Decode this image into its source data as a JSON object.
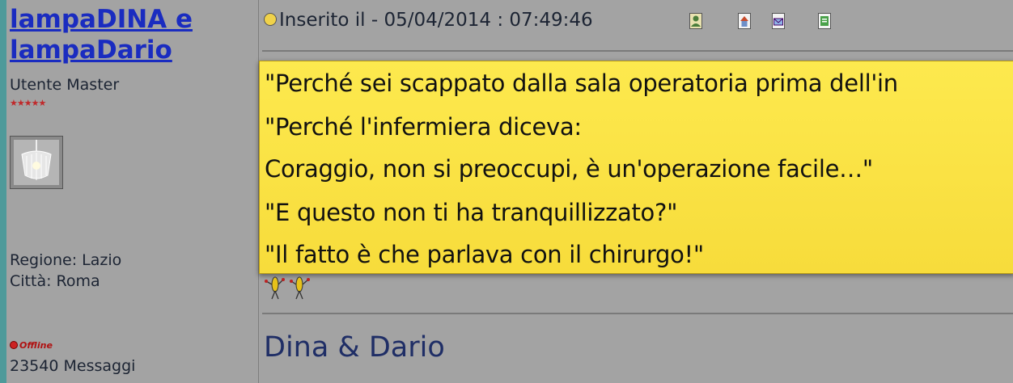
{
  "author": {
    "name": "lampaDINA e lampaDario",
    "rank": "Utente Master",
    "stars": "★★★★★"
  },
  "profile": {
    "region": "Regione: Lazio",
    "city": "Città: Roma",
    "status": "Offline",
    "messages": "23540 Messaggi"
  },
  "post": {
    "inserted": "Inserito il - 05/04/2014 : 07:49:46"
  },
  "note_lines": [
    "\"Perché sei scappato dalla sala operatoria prima dell'in",
    "\"Perché l'infermiera diceva:",
    "Coraggio, non si preoccupi, è un'operazione facile…\"",
    "\"E questo non ti ha tranquillizzato?\"",
    "\"Il fatto è che parlava con il chirurgo!\""
  ],
  "signature": "Dina & Dario",
  "colors": {
    "background": "#a3a3a3",
    "link": "#1a2cc0",
    "note": "#fde94e",
    "signature": "#1f2e66"
  }
}
